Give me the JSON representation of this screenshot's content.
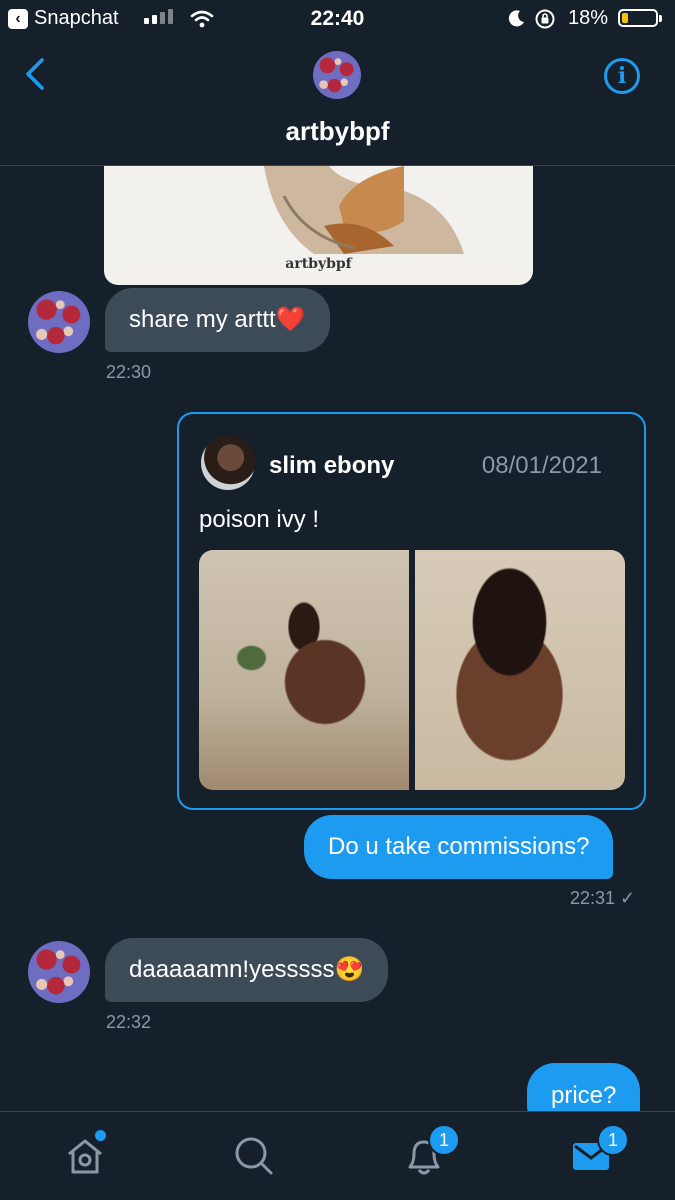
{
  "status_bar": {
    "back_app": "Snapchat",
    "time": "22:40",
    "battery": "18%"
  },
  "header": {
    "title": "artbybpf"
  },
  "artwork": {
    "caption": "artbybpf"
  },
  "messages": [
    {
      "text": "share my arttt❤️",
      "time": "22:30"
    },
    {
      "text": "Do u take commissions?",
      "time": "22:31 ✓"
    },
    {
      "text": "daaaaamn!yesssss😍",
      "time": "22:32"
    },
    {
      "text": "price?"
    }
  ],
  "quote": {
    "name": "slim ebony",
    "date": "08/01/2021",
    "text": "poison ivy !"
  },
  "tabbar": {
    "notifications_count": "1",
    "messages_count": "1"
  },
  "colors": {
    "background": "#15202b",
    "accent": "#1d9bf0",
    "incoming_bubble": "#3d4b59"
  }
}
